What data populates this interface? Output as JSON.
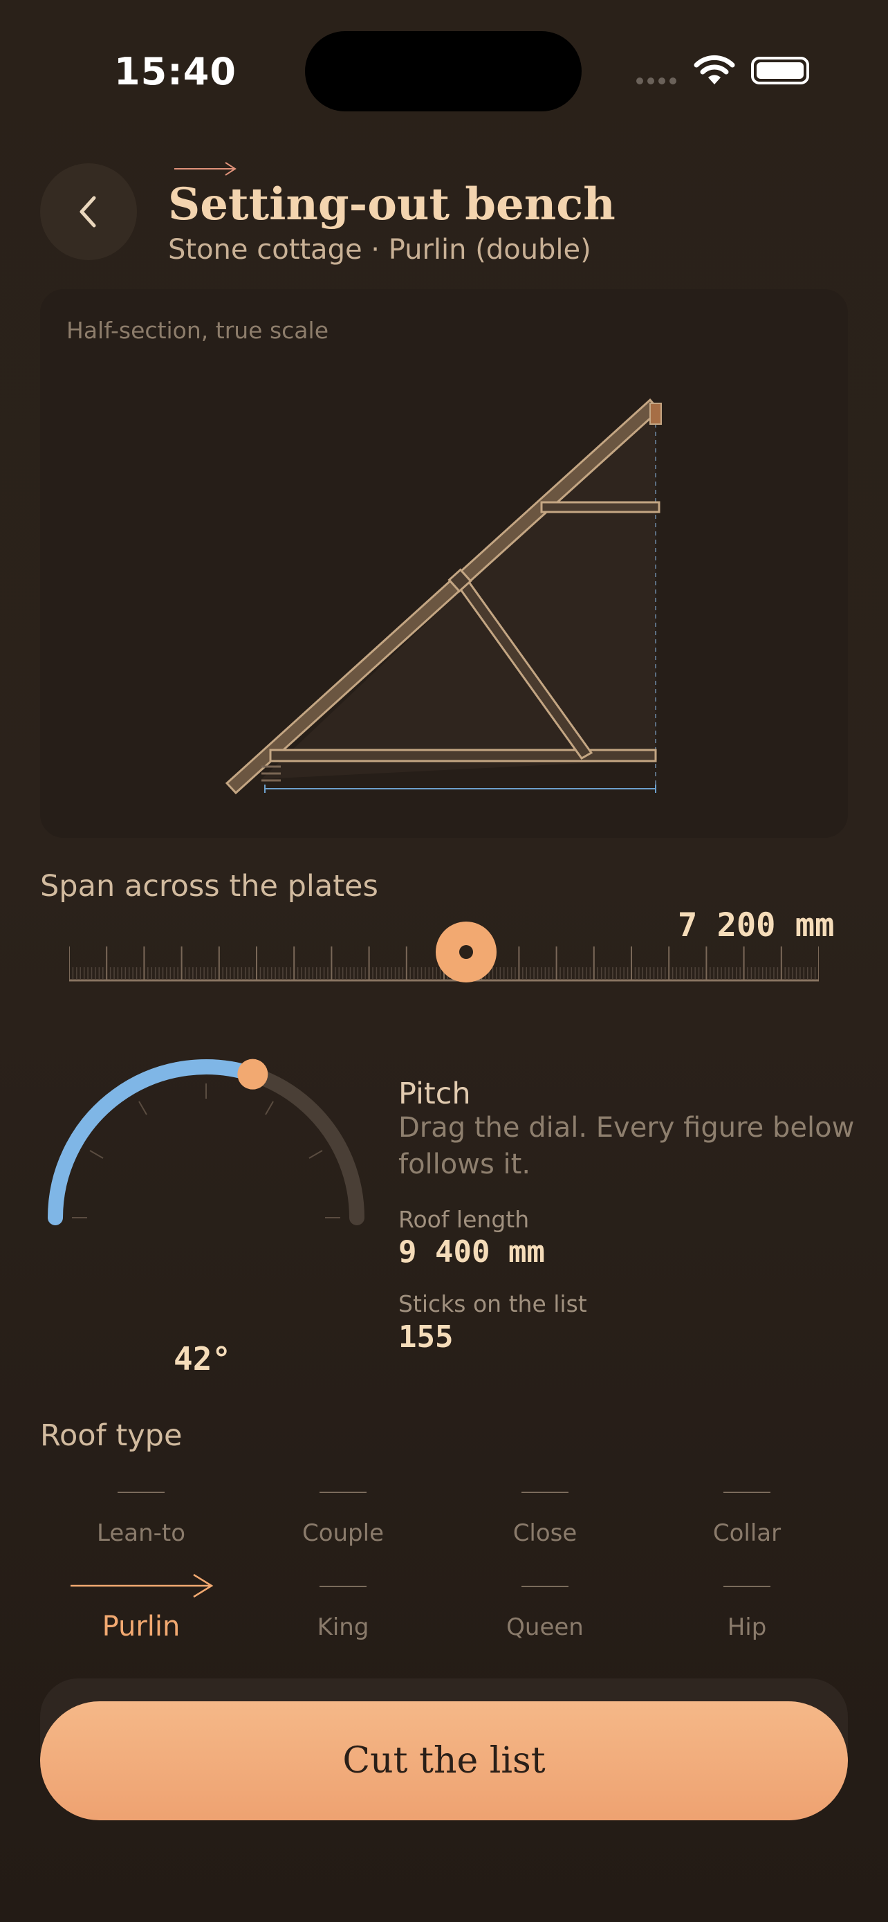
{
  "status": {
    "time": "15:40"
  },
  "header": {
    "title": "Setting-out bench",
    "subtitle": "Stone cottage · Purlin (double)"
  },
  "drawing": {
    "label": "Half-section, true scale"
  },
  "span": {
    "label": "Span across the plates",
    "value": "7 200 mm",
    "fraction": 0.53
  },
  "pitch": {
    "degrees_label": "42°",
    "degrees": 42,
    "title": "Pitch",
    "description": "Drag the dial. Every figure below follows it.",
    "roof_length_label": "Roof length",
    "roof_length_value": "9 400 mm",
    "sticks_label": "Sticks on the list",
    "sticks_value": "155"
  },
  "roof_type": {
    "label": "Roof type",
    "options": [
      "Lean-to",
      "Couple",
      "Close",
      "Collar",
      "Purlin",
      "King",
      "Queen",
      "Hip"
    ],
    "selected": "Purlin"
  },
  "cta": {
    "label": "Cut the list"
  },
  "colors": {
    "accent": "#f2a971",
    "dial_active": "#7fb6e6",
    "background": "#2a2119"
  }
}
